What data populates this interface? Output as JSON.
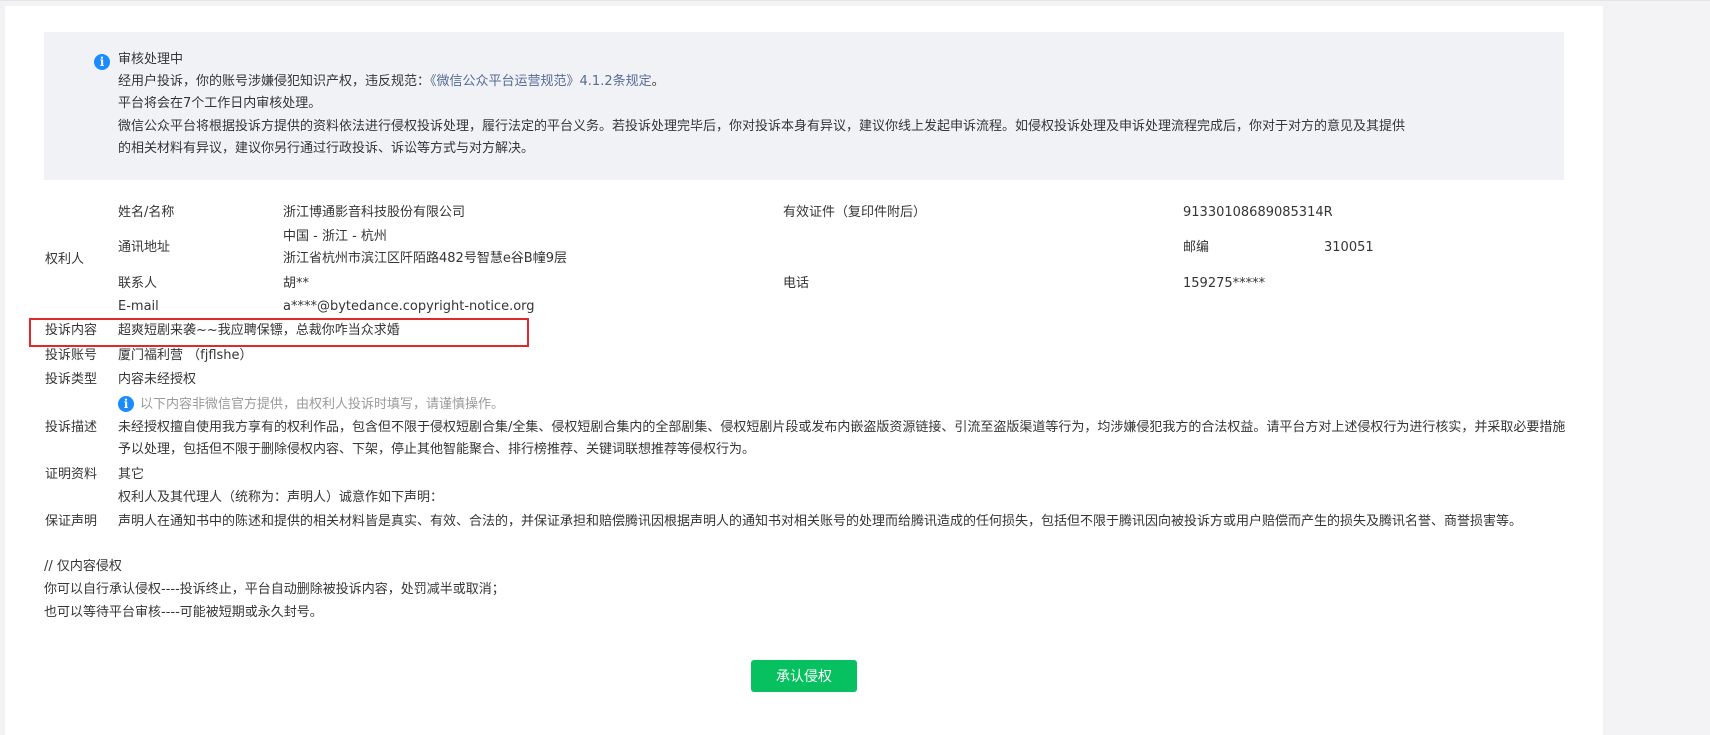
{
  "notice": {
    "title": "审核处理中",
    "line1_prefix": "经用户投诉，你的账号涉嫌侵犯知识产权，违反规范：",
    "line1_link": "《微信公众平台运营规范》4.1.2条规定",
    "line1_suffix": "。",
    "line2": "平台将会在7个工作日内审核处理。",
    "line3": "微信公众平台将根据投诉方提供的资料依法进行侵权投诉处理，履行法定的平台义务。若投诉处理完毕后，你对投诉本身有异议，建议你线上发起申诉流程。如侵权投诉处理及申诉处理流程完成后，你对于对方的意见及其提供",
    "line4": "的相关材料有异议，建议你另行通过行政投诉、诉讼等方式与对方解决。"
  },
  "rights_holder": {
    "section_label": "权利人",
    "name_label": "姓名/名称",
    "name_value": "浙江博通影音科技股份有限公司",
    "cert_label": "有效证件（复印件附后）",
    "cert_value": "91330108689085314R",
    "address_label": "通讯地址",
    "address_line1": "中国 - 浙江 - 杭州",
    "address_line2": "浙江省杭州市滨江区阡陌路482号智慧e谷B幢9层",
    "zip_label": "邮编",
    "zip_value": "310051",
    "contact_label": "联系人",
    "contact_value": "胡**",
    "phone_label": "电话",
    "phone_value": "159275*****",
    "email_label": "E-mail",
    "email_value": "a****@bytedance.copyright-notice.org"
  },
  "complaint": {
    "content_label": "投诉内容",
    "content_value": "超爽短剧来袭~~我应聘保镖，总裁你咋当众求婚",
    "account_label": "投诉账号",
    "account_value": "厦门福利营 （fjflshe）",
    "type_label": "投诉类型",
    "type_value": "内容未经授权",
    "disclaimer": "以下内容非微信官方提供，由权利人投诉时填写，请谨慎操作。",
    "desc_label": "投诉描述",
    "desc_value": "未经授权擅自使用我方享有的权利作品，包含但不限于侵权短剧合集/全集、侵权短剧合集内的全部剧集、侵权短剧片段或发布内嵌盗版资源链接、引流至盗版渠道等行为，均涉嫌侵犯我方的合法权益。请平台方对上述侵权行为进行核实，并采取必要措施予以处理，包括但不限于删除侵权内容、下架，停止其他智能聚合、排行榜推荐、关键词联想推荐等侵权行为。",
    "proof_label": "证明资料",
    "proof_value": "其它",
    "guarantee_label": "保证声明",
    "guarantee_intro": "权利人及其代理人（统称为：声明人）诚意作如下声明：",
    "guarantee_value": "声明人在通知书中的陈述和提供的相关材料皆是真实、有效、合法的，并保证承担和赔偿腾讯因根据声明人的通知书对相关账号的处理而给腾讯造成的任何损失，包括但不限于腾讯因向被投诉方或用户赔偿而产生的损失及腾讯名誉、商誉损害等。"
  },
  "footer_note": {
    "line1": "// 仅内容侵权",
    "line2": "你可以自行承认侵权----投诉终止，平台自动删除被投诉内容，处罚减半或取消；",
    "line3": "也可以等待平台审核----可能被短期或永久封号。"
  },
  "actions": {
    "admit_label": "承认侵权"
  },
  "colors": {
    "accent_green": "#07c160",
    "link_blue": "#576b95",
    "info_blue": "#1a8cff",
    "highlight_red": "#e0282e"
  }
}
